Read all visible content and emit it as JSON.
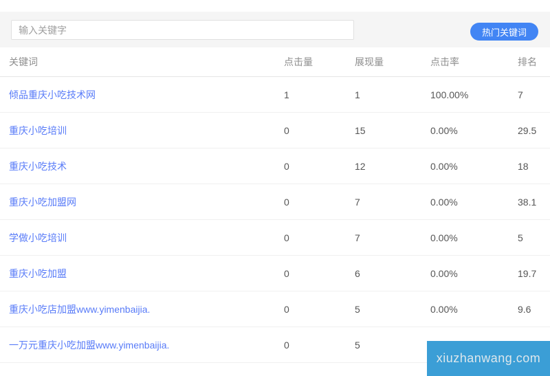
{
  "toolbar": {
    "search_placeholder": "输入关键字",
    "hot_keywords_button": "热门关键词"
  },
  "table": {
    "columns": {
      "keyword": "关键词",
      "clicks": "点击量",
      "impressions": "展现量",
      "ctr": "点击率",
      "rank": "排名"
    },
    "rows": [
      {
        "keyword": "倾品重庆小吃技术网",
        "clicks": "1",
        "impressions": "1",
        "ctr": "100.00%",
        "rank": "7"
      },
      {
        "keyword": "重庆小吃培训",
        "clicks": "0",
        "impressions": "15",
        "ctr": "0.00%",
        "rank": "29.5"
      },
      {
        "keyword": "重庆小吃技术",
        "clicks": "0",
        "impressions": "12",
        "ctr": "0.00%",
        "rank": "18"
      },
      {
        "keyword": "重庆小吃加盟网",
        "clicks": "0",
        "impressions": "7",
        "ctr": "0.00%",
        "rank": "38.1"
      },
      {
        "keyword": "学做小吃培训",
        "clicks": "0",
        "impressions": "7",
        "ctr": "0.00%",
        "rank": "5"
      },
      {
        "keyword": "重庆小吃加盟",
        "clicks": "0",
        "impressions": "6",
        "ctr": "0.00%",
        "rank": "19.7"
      },
      {
        "keyword": "重庆小吃店加盟www.yimenbaijia.",
        "clicks": "0",
        "impressions": "5",
        "ctr": "0.00%",
        "rank": "9.6"
      },
      {
        "keyword": "一万元重庆小吃加盟www.yimenbaijia.",
        "clicks": "0",
        "impressions": "5",
        "ctr": "",
        "rank": ""
      }
    ]
  },
  "watermark": {
    "text": "xiuzhanwang.com"
  },
  "colors": {
    "accent": "#4285f4",
    "link": "#587bf8",
    "header_text": "#8e8e8e",
    "cell_text": "#555555",
    "toolbar_bg": "#f5f5f5",
    "watermark_bg": "#3b9ed6",
    "watermark_text": "#dde7ec"
  }
}
